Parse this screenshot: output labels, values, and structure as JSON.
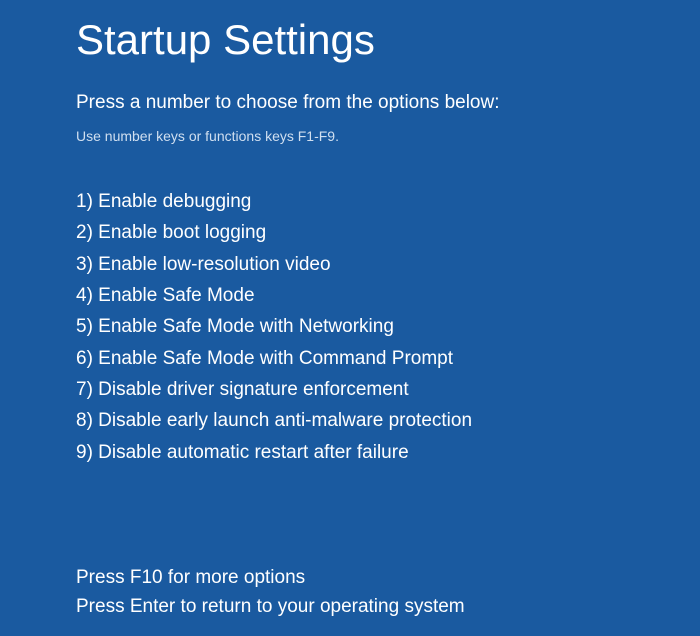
{
  "title": "Startup Settings",
  "subtitle": "Press a number to choose from the options below:",
  "hint": "Use number keys or functions keys F1-F9.",
  "options": [
    "1) Enable debugging",
    "2) Enable boot logging",
    "3) Enable low-resolution video",
    "4) Enable Safe Mode",
    "5) Enable Safe Mode with Networking",
    "6) Enable Safe Mode with Command Prompt",
    "7) Disable driver signature enforcement",
    "8) Disable early launch anti-malware protection",
    "9) Disable automatic restart after failure"
  ],
  "footer": {
    "f10": "Press F10 for more options",
    "enter": "Press Enter to return to your operating system"
  }
}
